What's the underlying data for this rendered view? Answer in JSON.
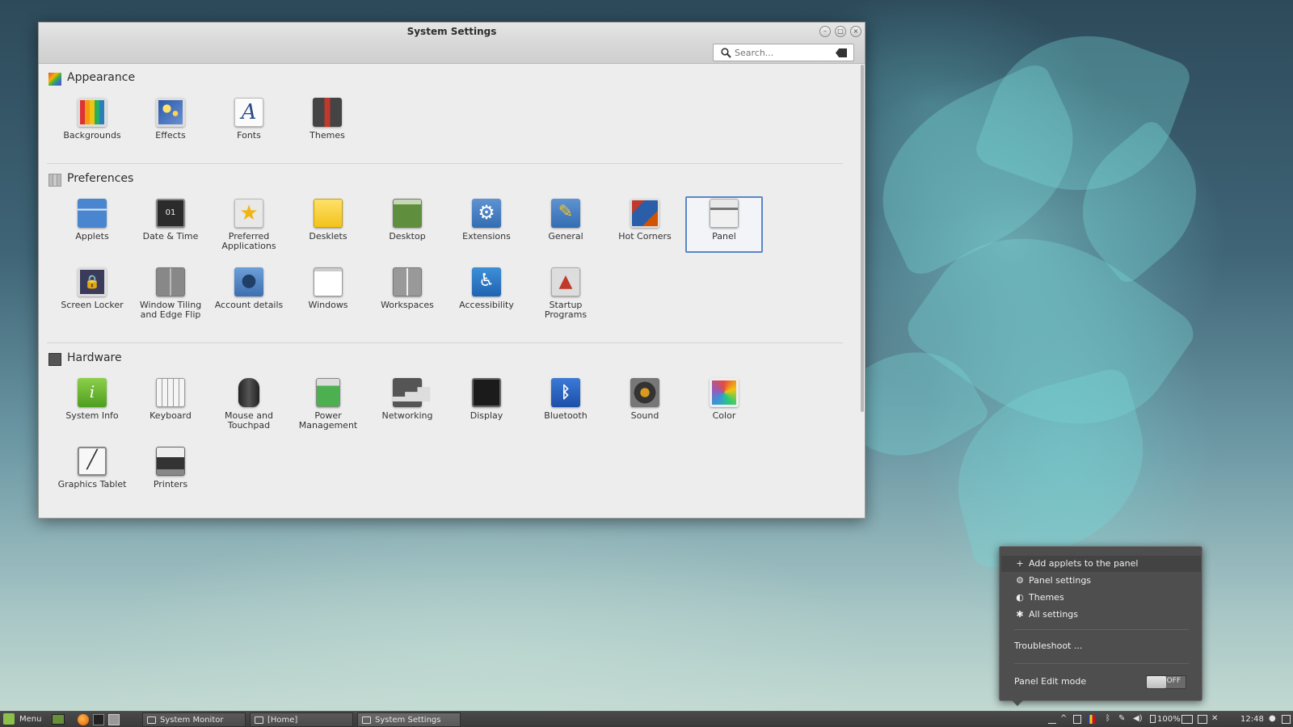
{
  "window": {
    "title": "System Settings",
    "search_placeholder": "Search..."
  },
  "sections": [
    {
      "title": "Appearance",
      "items": [
        {
          "label": "Backgrounds",
          "icon": "backgrounds-icon"
        },
        {
          "label": "Effects",
          "icon": "effects-icon"
        },
        {
          "label": "Fonts",
          "icon": "fonts-icon"
        },
        {
          "label": "Themes",
          "icon": "themes-icon"
        }
      ]
    },
    {
      "title": "Preferences",
      "items": [
        {
          "label": "Applets",
          "icon": "applets-icon"
        },
        {
          "label": "Date & Time",
          "icon": "date-time-icon"
        },
        {
          "label": "Preferred Applications",
          "icon": "preferred-applications-icon"
        },
        {
          "label": "Desklets",
          "icon": "desklets-icon"
        },
        {
          "label": "Desktop",
          "icon": "desktop-icon"
        },
        {
          "label": "Extensions",
          "icon": "extensions-icon"
        },
        {
          "label": "General",
          "icon": "general-icon"
        },
        {
          "label": "Hot Corners",
          "icon": "hot-corners-icon"
        },
        {
          "label": "Panel",
          "icon": "panel-icon",
          "selected": true
        },
        {
          "label": "Screen Locker",
          "icon": "screen-locker-icon"
        },
        {
          "label": "Window Tiling and Edge Flip",
          "icon": "window-tiling-icon"
        },
        {
          "label": "Account details",
          "icon": "account-details-icon"
        },
        {
          "label": "Windows",
          "icon": "windows-icon"
        },
        {
          "label": "Workspaces",
          "icon": "workspaces-icon"
        },
        {
          "label": "Accessibility",
          "icon": "accessibility-icon"
        },
        {
          "label": "Startup Programs",
          "icon": "startup-programs-icon"
        }
      ]
    },
    {
      "title": "Hardware",
      "items": [
        {
          "label": "System Info",
          "icon": "system-info-icon"
        },
        {
          "label": "Keyboard",
          "icon": "keyboard-icon"
        },
        {
          "label": "Mouse and Touchpad",
          "icon": "mouse-icon"
        },
        {
          "label": "Power Management",
          "icon": "battery-icon"
        },
        {
          "label": "Networking",
          "icon": "networking-icon"
        },
        {
          "label": "Display",
          "icon": "display-icon"
        },
        {
          "label": "Bluetooth",
          "icon": "bluetooth-icon"
        },
        {
          "label": "Sound",
          "icon": "speaker-icon"
        },
        {
          "label": "Color",
          "icon": "color-icon"
        },
        {
          "label": "Graphics Tablet",
          "icon": "graphics-tablet-icon"
        },
        {
          "label": "Printers",
          "icon": "printer-icon"
        }
      ]
    }
  ],
  "context_menu": {
    "items": [
      {
        "label": "Add applets to the panel",
        "icon": "plus-icon"
      },
      {
        "label": "Panel settings",
        "icon": "gear-icon"
      },
      {
        "label": "Themes",
        "icon": "themes-icon"
      },
      {
        "label": "All settings",
        "icon": "settings-icon"
      }
    ],
    "troubleshoot": "Troubleshoot ...",
    "edit_mode_label": "Panel Edit mode",
    "edit_mode_state": "OFF"
  },
  "taskbar": {
    "menu_label": "Menu",
    "tasks": [
      "System Monitor",
      "[Home]",
      "System Settings"
    ],
    "battery": "100%",
    "clock": "12:48"
  }
}
